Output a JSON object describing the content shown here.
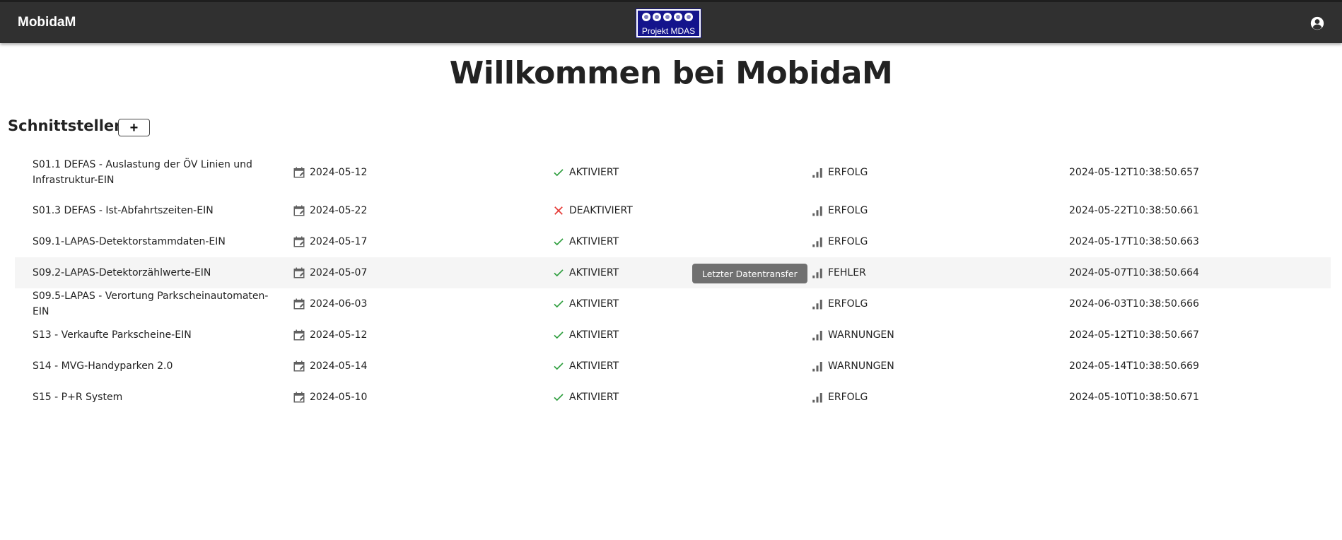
{
  "header": {
    "app_title": "MobidaM",
    "logo_text": "Projekt MDAS",
    "account_icon": "account-circle-icon"
  },
  "page": {
    "title": "Willkommen bei MobidaM"
  },
  "section": {
    "title": "Schnittstellen",
    "add_label": "+"
  },
  "tooltip": {
    "text": "Letzter Datentransfer"
  },
  "colors": {
    "appbar": "#303030",
    "logo_bg": "#14148c",
    "check": "#2e9e3e",
    "cross": "#e53935",
    "icon_gray": "#616161"
  },
  "rows": [
    {
      "name": "S01.1 DEFAS - Auslastung der ÖV Linien und Infrastruktur-EIN",
      "date": "2024-05-12",
      "status": "AKTIVIERT",
      "status_icon": "check-icon",
      "result": "ERFOLG",
      "timestamp": "2024-05-12T10:38:50.657"
    },
    {
      "name": "S01.3 DEFAS - Ist-Abfahrtszeiten-EIN",
      "date": "2024-05-22",
      "status": "DEAKTIVIERT",
      "status_icon": "close-icon",
      "result": "ERFOLG",
      "timestamp": "2024-05-22T10:38:50.661"
    },
    {
      "name": "S09.1-LAPAS-Detektorstammdaten-EIN",
      "date": "2024-05-17",
      "status": "AKTIVIERT",
      "status_icon": "check-icon",
      "result": "ERFOLG",
      "timestamp": "2024-05-17T10:38:50.663"
    },
    {
      "name": "S09.2-LAPAS-Detektorzählwerte-EIN",
      "date": "2024-05-07",
      "status": "AKTIVIERT",
      "status_icon": "check-icon",
      "result": "FEHLER",
      "timestamp": "2024-05-07T10:38:50.664"
    },
    {
      "name": "S09.5-LAPAS - Verortung Parkscheinautomaten-EIN",
      "date": "2024-06-03",
      "status": "AKTIVIERT",
      "status_icon": "check-icon",
      "result": "ERFOLG",
      "timestamp": "2024-06-03T10:38:50.666"
    },
    {
      "name": "S13 - Verkaufte Parkscheine-EIN",
      "date": "2024-05-12",
      "status": "AKTIVIERT",
      "status_icon": "check-icon",
      "result": "WARNUNGEN",
      "timestamp": "2024-05-12T10:38:50.667"
    },
    {
      "name": "S14 - MVG-Handyparken 2.0",
      "date": "2024-05-14",
      "status": "AKTIVIERT",
      "status_icon": "check-icon",
      "result": "WARNUNGEN",
      "timestamp": "2024-05-14T10:38:50.669"
    },
    {
      "name": "S15 - P+R System",
      "date": "2024-05-10",
      "status": "AKTIVIERT",
      "status_icon": "check-icon",
      "result": "ERFOLG",
      "timestamp": "2024-05-10T10:38:50.671"
    }
  ]
}
